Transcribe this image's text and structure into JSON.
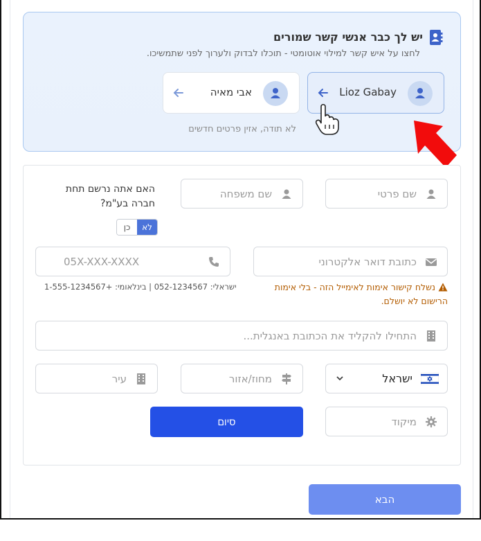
{
  "banner": {
    "title": "יש לך כבר אנשי קשר שמורים",
    "subtitle": "לחצו על איש קשר למילוי אוטומטי - תוכלו לבדוק ולערוך לפני שתמשיכו.",
    "icon": "contacts-book-icon",
    "contacts": [
      {
        "name": "Lioz Gabay",
        "selected": true
      },
      {
        "name": "אבי מאיה",
        "selected": false
      }
    ],
    "no_thanks": "לא תודה, אזין פרטים חדשים"
  },
  "form": {
    "first_name_placeholder": "שם פרטי",
    "last_name_placeholder": "שם משפחה",
    "company_question": "האם אתה נרשם תחת חברה בע\"מ?",
    "toggle": {
      "yes": "כן",
      "no": "לא",
      "selected": "no"
    },
    "email_placeholder": "כתובת דואר אלקטרוני",
    "phone_placeholder": "05X-XXX-XXXX",
    "email_warning": "נשלח קישור אימות לאימייל הזה - בלי אימות הרישום לא יושלם.",
    "phone_hint": "ישראלי: 052-1234567 | בינלאומי: +1-555-1234567",
    "address_placeholder": "התחילו להקליד את הכתובת באנגלית...",
    "country_value": "ישראל",
    "region_placeholder": "מחוז/אזור",
    "city_placeholder": "עיר",
    "zip_placeholder": "מיקוד",
    "finish_label": "סיום"
  },
  "next_label": "הבא",
  "colors": {
    "primary": "#2450e6",
    "next": "#6d8ef0",
    "banner_bg": "#eaf2fd",
    "warning": "#b35c00"
  }
}
